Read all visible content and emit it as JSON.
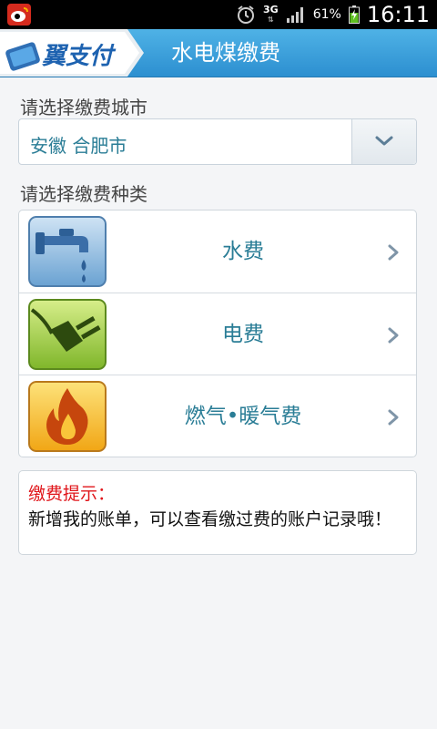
{
  "status_bar": {
    "network": "3G",
    "battery_text": "61%",
    "time": "16:11",
    "icons": [
      "weibo-icon",
      "alarm-icon",
      "signal-icon",
      "battery-charging-icon"
    ]
  },
  "header": {
    "logo_text": "翼支付",
    "title": "水电煤缴费"
  },
  "city_section": {
    "label": "请选择缴费城市",
    "selected_city": "安徽 合肥市"
  },
  "type_section": {
    "label": "请选择缴费种类",
    "items": [
      {
        "label": "水费",
        "icon": "water-tap-icon"
      },
      {
        "label": "电费",
        "icon": "plug-icon"
      },
      {
        "label": "燃气•暖气费",
        "icon": "flame-icon"
      }
    ]
  },
  "tips": {
    "title": "缴费提示：",
    "body": "新增我的账单，可以查看缴过费的账户记录哦！"
  },
  "colors": {
    "header_top": "#4fb2e6",
    "header_bottom": "#2c8fd0",
    "accent_text": "#2a7d96",
    "tip_title": "#e0151a"
  }
}
